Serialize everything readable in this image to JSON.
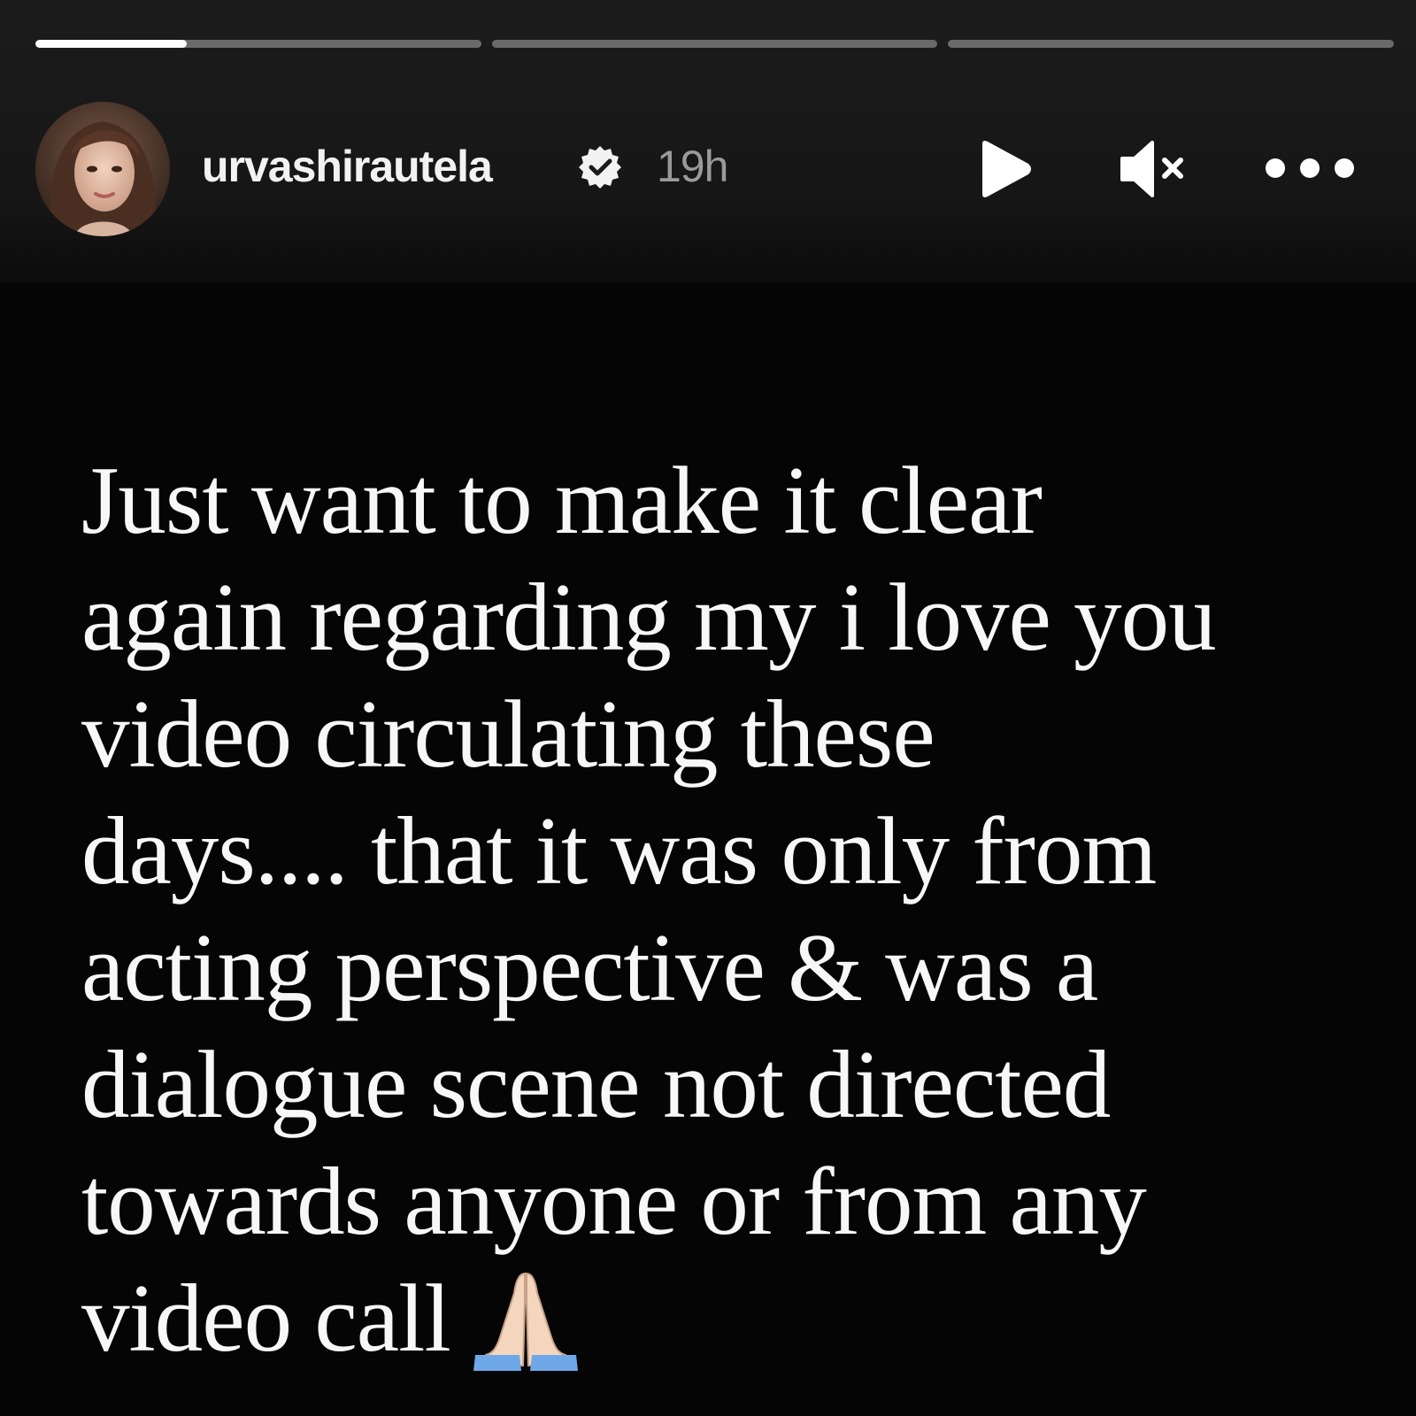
{
  "story": {
    "progress_segments": [
      {
        "progress": 0.34
      },
      {
        "progress": 0
      },
      {
        "progress": 0
      }
    ],
    "user": {
      "username": "urvashirautela",
      "verified": true,
      "timestamp": "19h"
    },
    "controls": {
      "play_icon": "play-icon",
      "mute_icon": "volume-muted-icon",
      "more_icon": "more-options-icon"
    },
    "caption": {
      "lines": [
        "Just want to make it clear",
        "again regarding my i love you",
        "video circulating these",
        "days.... that it was only from",
        "acting perspective & was a",
        "dialogue scene not directed",
        "towards anyone or from any",
        "video call"
      ],
      "emoji": "folded-hands-emoji"
    },
    "colors": {
      "background": "#050505",
      "text": "#f7f7f7",
      "timestamp": "#9a9a9a"
    }
  }
}
